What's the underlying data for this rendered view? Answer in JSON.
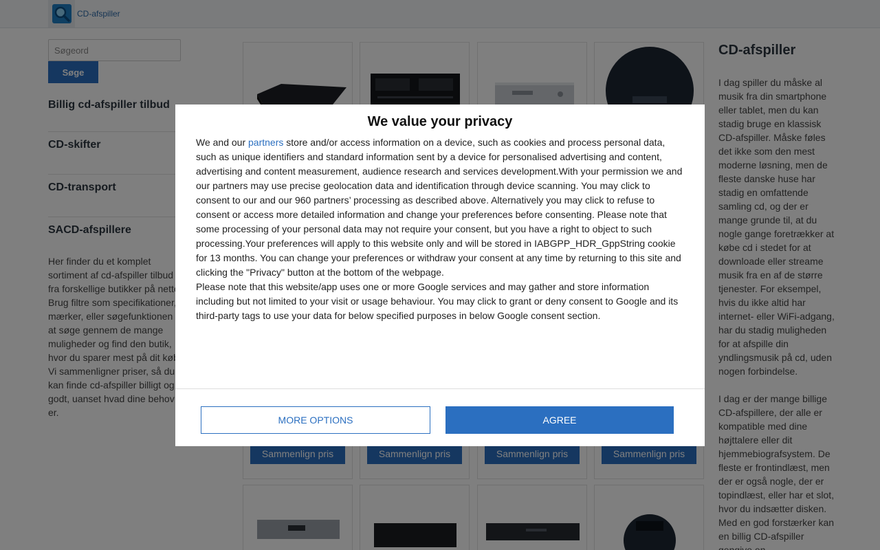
{
  "header": {
    "brand": "CD-afspiller",
    "logo_icon": "search-magnifier-icon"
  },
  "sidebar": {
    "search_placeholder": "Søgeord",
    "search_button": "Søge",
    "nav": [
      {
        "label": "Billig cd-afspiller tilbud"
      },
      {
        "label": "CD-skifter"
      },
      {
        "label": "CD-transport"
      },
      {
        "label": "SACD-afspillere"
      }
    ],
    "description": "Her finder du et komplet sortiment af cd-afspiller tilbud fra forskellige butikker på nettet. Brug filtre som specifikationer, mærker, eller søgefunktionen til at søge gennem de mange muligheder og find den butik, hvor du sparer mest på dit køb. Vi sammenligner priser, så du kan finde cd-afspiller billigt og godt, uanset hvad dine behov er."
  },
  "products": {
    "compare_label": "Sammenlign pris",
    "row1_icons": [
      "cd-player-black-icon",
      "cassette-deck-icon",
      "cd-player-silver-icon",
      "portable-cd-player-icon"
    ],
    "row2_icons": [
      "amplifier-silver-icon",
      "cd-player-black-icon",
      "dvd-player-icon",
      "portable-cd-player-icon"
    ]
  },
  "right": {
    "title": "CD-afspiller",
    "p1": "I dag spiller du måske al musik fra din smartphone eller tablet, men du kan stadig bruge en klassisk CD-afspiller. Måske føles det ikke som den mest moderne løsning, men de fleste danske huse har stadig en omfattende samling cd, og der er mange grunde til, at du nogle gange foretrækker at købe cd i stedet for at downloade eller streame musik fra en af de større tjenester. For eksempel, hvis du ikke altid har internet- eller WiFi-adgang, har du stadig muligheden for at afspille din yndlingsmusik på cd, uden nogen forbindelse.",
    "p2": "I dag er der mange billige CD-afspillere, der alle er kompatible med dine højttalere eller dit hjemmebiografsystem. De fleste er frontindlæst, men der er også nogle, der er topindlæst, eller har et slot, hvor du indsætter disken. Med en god forstærker kan en billig CD-afspiller gengive en"
  },
  "consent": {
    "title": "We value your privacy",
    "intro_before": "We and our ",
    "partners_link": "partners",
    "intro_after": " store and/or access information on a device, such as cookies and process personal data, such as unique identifiers and standard information sent by a device for personalised advertising and content, advertising and content measurement, audience research and services development.With your permission we and our partners may use precise geolocation data and identification through device scanning. You may click to consent to our and our 960 partners’ processing as described above. Alternatively you may click to refuse to consent or access more detailed information and change your preferences before consenting. Please note that some processing of your personal data may not require your consent, but you have a right to object to such processing.Your preferences will apply to this website only and will be stored in IABGPP_HDR_GppString cookie for 13 months. You can change your preferences or withdraw your consent at any time by returning to this site and clicking the \"Privacy\" button at the bottom of the webpage.",
    "google_notice": "Please note that this website/app uses one or more Google services and may gather and store information including but not limited to your visit or usage behaviour. You may click to grant or deny consent to Google and its third-party tags to use your data for below specified purposes in below Google consent section.",
    "more_options": "MORE OPTIONS",
    "agree": "AGREE"
  }
}
